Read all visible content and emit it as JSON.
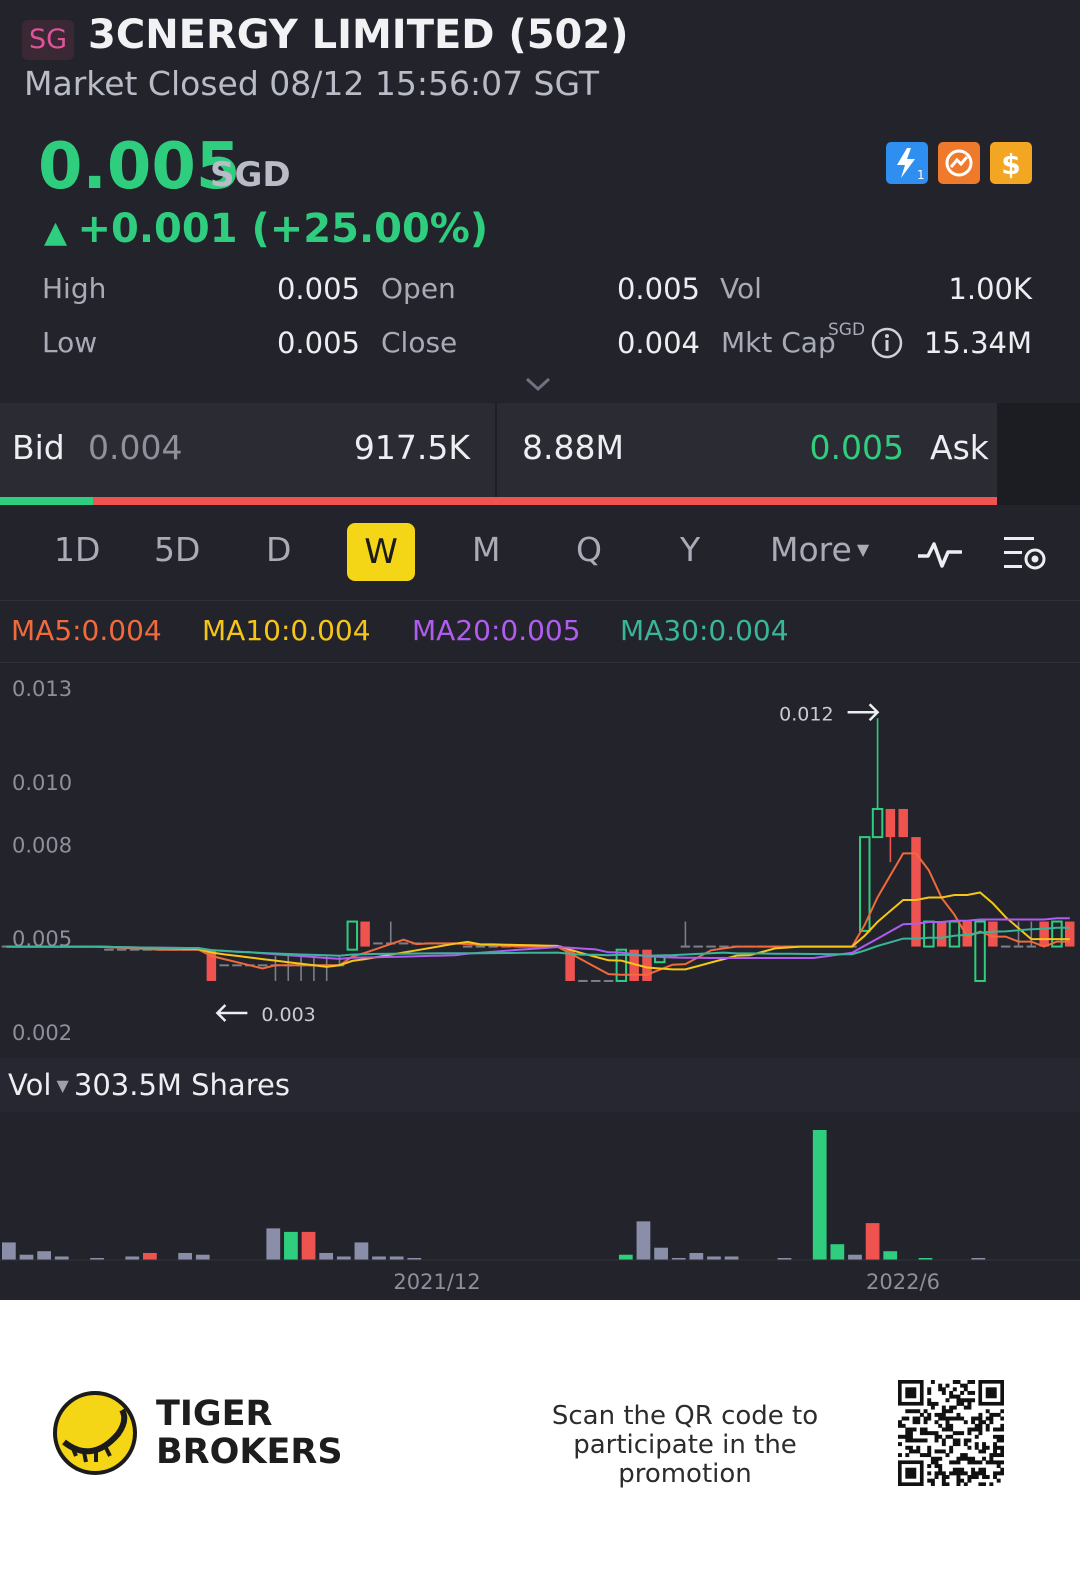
{
  "header": {
    "market_badge": "SG",
    "title": "3CNERGY LIMITED (502)",
    "status": "Market Closed 08/12 15:56:07 SGT"
  },
  "quote": {
    "price": "0.005",
    "currency": "SGD",
    "change": "+0.001 (+25.00%)",
    "up_color": "#2fce7e",
    "down_color": "#ef5350"
  },
  "icons": [
    "lightning-icon",
    "trade-icon",
    "dollar-icon"
  ],
  "stats": {
    "high_label": "High",
    "high": "0.005",
    "open_label": "Open",
    "open": "0.005",
    "vol_label": "Vol",
    "vol": "1.00K",
    "low_label": "Low",
    "low": "0.005",
    "close_label": "Close",
    "close": "0.004",
    "mktcap_label": "Mkt Cap",
    "mktcap_currency": "SGD",
    "mktcap": "15.34M"
  },
  "orderbook": {
    "bid_label": "Bid",
    "bid_price": "0.004",
    "bid_size": "917.5K",
    "ask_size": "8.88M",
    "ask_price": "0.005",
    "ask_label": "Ask",
    "bid_ratio": 0.093
  },
  "periods": [
    "1D",
    "5D",
    "D",
    "W",
    "M",
    "Q",
    "Y"
  ],
  "active_period": "W",
  "more_label": "More",
  "ma": {
    "ma5": "MA5:0.004",
    "ma10": "MA10:0.004",
    "ma20": "MA20:0.005",
    "ma30": "MA30:0.004",
    "ma5_color": "#f06a3c",
    "ma10_color": "#f5c518",
    "ma20_color": "#b15cf0",
    "ma30_color": "#39b59a"
  },
  "volume_header": {
    "label": "Vol",
    "value": "303.5M Shares"
  },
  "footer": {
    "brand_line1": "TIGER",
    "brand_line2": "BROKERS",
    "scan_line1": "Scan the QR code to",
    "scan_line2": "participate in the promotion"
  },
  "chart_data": {
    "type": "candlestick",
    "yticks": [
      "0.013",
      "0.010",
      "0.008",
      "0.005",
      "0.002"
    ],
    "ylim": [
      0.002,
      0.013
    ],
    "xticks": [
      "2021/12",
      "2022/6"
    ],
    "max_annotation": "0.012",
    "min_annotation": "0.003",
    "candles": [
      {
        "o": 0.0047,
        "h": 0.0047,
        "l": 0.0047,
        "c": 0.0047
      },
      {
        "o": 0.0047,
        "h": 0.0047,
        "l": 0.0047,
        "c": 0.0047
      },
      {
        "o": 0.0047,
        "h": 0.0047,
        "l": 0.0047,
        "c": 0.0047
      },
      {
        "o": 0.0047,
        "h": 0.0047,
        "l": 0.0047,
        "c": 0.0047
      },
      {
        "o": 0.0047,
        "h": 0.0047,
        "l": 0.0047,
        "c": 0.0047
      },
      {
        "o": 0.0047,
        "h": 0.0047,
        "l": 0.0047,
        "c": 0.0047
      },
      {
        "o": 0.0047,
        "h": 0.0047,
        "l": 0.0047,
        "c": 0.0047
      },
      {
        "o": 0.0047,
        "h": 0.0047,
        "l": 0.0047,
        "c": 0.0047
      },
      {
        "o": 0.0046,
        "h": 0.0046,
        "l": 0.0046,
        "c": 0.0046
      },
      {
        "o": 0.0046,
        "h": 0.0046,
        "l": 0.0046,
        "c": 0.0046
      },
      {
        "o": 0.0046,
        "h": 0.0046,
        "l": 0.0046,
        "c": 0.0046
      },
      {
        "o": 0.0046,
        "h": 0.0046,
        "l": 0.0046,
        "c": 0.0046
      },
      {
        "o": 0.0046,
        "h": 0.0046,
        "l": 0.0046,
        "c": 0.0046
      },
      {
        "o": 0.0046,
        "h": 0.0046,
        "l": 0.0046,
        "c": 0.0046
      },
      {
        "o": 0.0046,
        "h": 0.0046,
        "l": 0.0046,
        "c": 0.0046
      },
      {
        "o": 0.0046,
        "h": 0.0046,
        "l": 0.0046,
        "c": 0.0046
      },
      {
        "o": 0.0046,
        "h": 0.0046,
        "l": 0.0036,
        "c": 0.0036
      },
      {
        "o": 0.0041,
        "h": 0.0041,
        "l": 0.0041,
        "c": 0.0041
      },
      {
        "o": 0.0041,
        "h": 0.0041,
        "l": 0.0041,
        "c": 0.0041
      },
      {
        "o": 0.0041,
        "h": 0.0041,
        "l": 0.0041,
        "c": 0.0041
      },
      {
        "o": 0.0041,
        "h": 0.0041,
        "l": 0.0041,
        "c": 0.0041
      },
      {
        "o": 0.0041,
        "h": 0.0044,
        "l": 0.0036,
        "c": 0.0041
      },
      {
        "o": 0.0041,
        "h": 0.0044,
        "l": 0.0036,
        "c": 0.0041
      },
      {
        "o": 0.0041,
        "h": 0.0044,
        "l": 0.0036,
        "c": 0.0041
      },
      {
        "o": 0.0041,
        "h": 0.0044,
        "l": 0.0036,
        "c": 0.0041
      },
      {
        "o": 0.0041,
        "h": 0.0044,
        "l": 0.0036,
        "c": 0.0041
      },
      {
        "o": 0.0041,
        "h": 0.0044,
        "l": 0.0041,
        "c": 0.0041
      },
      {
        "o": 0.0046,
        "h": 0.0055,
        "l": 0.0046,
        "c": 0.0055
      },
      {
        "o": 0.0055,
        "h": 0.0055,
        "l": 0.0047,
        "c": 0.0047
      },
      {
        "o": 0.0048,
        "h": 0.0048,
        "l": 0.0048,
        "c": 0.0048
      },
      {
        "o": 0.0048,
        "h": 0.0055,
        "l": 0.0048,
        "c": 0.0048
      },
      {
        "o": 0.0048,
        "h": 0.0048,
        "l": 0.0048,
        "c": 0.0048
      },
      {
        "o": 0.0048,
        "h": 0.0048,
        "l": 0.0048,
        "c": 0.0048
      },
      {
        "o": 0.0048,
        "h": 0.0048,
        "l": 0.0048,
        "c": 0.0048
      },
      {
        "o": 0.0048,
        "h": 0.0048,
        "l": 0.0048,
        "c": 0.0048
      },
      {
        "o": 0.0048,
        "h": 0.0048,
        "l": 0.0048,
        "c": 0.0048
      },
      {
        "o": 0.0047,
        "h": 0.0047,
        "l": 0.0047,
        "c": 0.0047
      },
      {
        "o": 0.0047,
        "h": 0.0047,
        "l": 0.0047,
        "c": 0.0047
      },
      {
        "o": 0.0047,
        "h": 0.0047,
        "l": 0.0047,
        "c": 0.0047
      },
      {
        "o": 0.0047,
        "h": 0.0047,
        "l": 0.0047,
        "c": 0.0047
      },
      {
        "o": 0.0047,
        "h": 0.0047,
        "l": 0.0047,
        "c": 0.0047
      },
      {
        "o": 0.0047,
        "h": 0.0047,
        "l": 0.0047,
        "c": 0.0047
      },
      {
        "o": 0.0047,
        "h": 0.0047,
        "l": 0.0047,
        "c": 0.0047
      },
      {
        "o": 0.0047,
        "h": 0.0047,
        "l": 0.0047,
        "c": 0.0047
      },
      {
        "o": 0.0046,
        "h": 0.0046,
        "l": 0.0036,
        "c": 0.0036
      },
      {
        "o": 0.0036,
        "h": 0.0036,
        "l": 0.0036,
        "c": 0.0036
      },
      {
        "o": 0.0036,
        "h": 0.0036,
        "l": 0.0036,
        "c": 0.0036
      },
      {
        "o": 0.0036,
        "h": 0.0036,
        "l": 0.0036,
        "c": 0.0036
      },
      {
        "o": 0.0036,
        "h": 0.0046,
        "l": 0.0036,
        "c": 0.0046
      },
      {
        "o": 0.0046,
        "h": 0.0046,
        "l": 0.0036,
        "c": 0.0036
      },
      {
        "o": 0.0046,
        "h": 0.0046,
        "l": 0.0036,
        "c": 0.0036
      },
      {
        "o": 0.0042,
        "h": 0.0044,
        "l": 0.0042,
        "c": 0.0044
      },
      {
        "o": 0.0044,
        "h": 0.0044,
        "l": 0.0044,
        "c": 0.0044
      },
      {
        "o": 0.0047,
        "h": 0.0055,
        "l": 0.0047,
        "c": 0.0047
      },
      {
        "o": 0.0047,
        "h": 0.0047,
        "l": 0.0047,
        "c": 0.0047
      },
      {
        "o": 0.0047,
        "h": 0.0047,
        "l": 0.0047,
        "c": 0.0047
      },
      {
        "o": 0.0047,
        "h": 0.0047,
        "l": 0.0047,
        "c": 0.0047
      },
      {
        "o": 0.0047,
        "h": 0.0047,
        "l": 0.0047,
        "c": 0.0047
      },
      {
        "o": 0.0047,
        "h": 0.0047,
        "l": 0.0047,
        "c": 0.0047
      },
      {
        "o": 0.0047,
        "h": 0.0047,
        "l": 0.0047,
        "c": 0.0047
      },
      {
        "o": 0.0047,
        "h": 0.0047,
        "l": 0.0047,
        "c": 0.0047
      },
      {
        "o": 0.0047,
        "h": 0.0047,
        "l": 0.0047,
        "c": 0.0047
      },
      {
        "o": 0.0047,
        "h": 0.0047,
        "l": 0.0047,
        "c": 0.0047
      },
      {
        "o": 0.0047,
        "h": 0.0047,
        "l": 0.0047,
        "c": 0.0047
      },
      {
        "o": 0.0047,
        "h": 0.0047,
        "l": 0.0047,
        "c": 0.0047
      },
      {
        "o": 0.0047,
        "h": 0.0047,
        "l": 0.0047,
        "c": 0.0047
      },
      {
        "o": 0.0047,
        "h": 0.0047,
        "l": 0.0047,
        "c": 0.0047
      },
      {
        "o": 0.0052,
        "h": 0.0082,
        "l": 0.0052,
        "c": 0.0082
      },
      {
        "o": 0.0082,
        "h": 0.012,
        "l": 0.0082,
        "c": 0.0091
      },
      {
        "o": 0.0091,
        "h": 0.0091,
        "l": 0.0074,
        "c": 0.0082
      },
      {
        "o": 0.0091,
        "h": 0.0091,
        "l": 0.0082,
        "c": 0.0082
      },
      {
        "o": 0.0082,
        "h": 0.0082,
        "l": 0.0047,
        "c": 0.0047
      },
      {
        "o": 0.0047,
        "h": 0.0055,
        "l": 0.0047,
        "c": 0.0055
      },
      {
        "o": 0.0055,
        "h": 0.0055,
        "l": 0.0047,
        "c": 0.0047
      },
      {
        "o": 0.0047,
        "h": 0.0055,
        "l": 0.0047,
        "c": 0.0055
      },
      {
        "o": 0.0055,
        "h": 0.0055,
        "l": 0.0047,
        "c": 0.0047
      },
      {
        "o": 0.0036,
        "h": 0.0055,
        "l": 0.0036,
        "c": 0.0055
      },
      {
        "o": 0.0055,
        "h": 0.0055,
        "l": 0.0047,
        "c": 0.0047
      },
      {
        "o": 0.0047,
        "h": 0.0047,
        "l": 0.0047,
        "c": 0.0047
      },
      {
        "o": 0.0047,
        "h": 0.0055,
        "l": 0.0047,
        "c": 0.0047
      },
      {
        "o": 0.0047,
        "h": 0.0055,
        "l": 0.0047,
        "c": 0.0047
      },
      {
        "o": 0.0055,
        "h": 0.0055,
        "l": 0.0047,
        "c": 0.0047
      },
      {
        "o": 0.0047,
        "h": 0.0055,
        "l": 0.0047,
        "c": 0.0055
      },
      {
        "o": 0.0055,
        "h": 0.0055,
        "l": 0.0047,
        "c": 0.0047
      }
    ],
    "volumes": [
      {
        "v": 0.1,
        "up": false
      },
      {
        "v": 0.03,
        "up": false
      },
      {
        "v": 0.05,
        "up": false
      },
      {
        "v": 0.02,
        "up": false
      },
      {
        "v": 0.0,
        "up": false
      },
      {
        "v": 0.01,
        "up": false
      },
      {
        "v": 0.0,
        "up": false
      },
      {
        "v": 0.02,
        "up": false
      },
      {
        "v": 0.04,
        "up": false
      },
      {
        "v": 0.0,
        "up": false
      },
      {
        "v": 0.04,
        "up": false
      },
      {
        "v": 0.03,
        "up": false
      },
      {
        "v": 0.0,
        "up": false
      },
      {
        "v": 0.0,
        "up": false
      },
      {
        "v": 0.0,
        "up": false
      },
      {
        "v": 0.18,
        "up": false
      },
      {
        "v": 0.16,
        "up": true
      },
      {
        "v": 0.16,
        "up": false
      },
      {
        "v": 0.04,
        "up": false
      },
      {
        "v": 0.02,
        "up": false
      },
      {
        "v": 0.1,
        "up": false
      },
      {
        "v": 0.02,
        "up": false
      },
      {
        "v": 0.02,
        "up": false
      },
      {
        "v": 0.01,
        "up": false
      },
      {
        "v": 0.0,
        "up": false
      },
      {
        "v": 0.0,
        "up": false
      },
      {
        "v": 0.0,
        "up": false
      },
      {
        "v": 0.0,
        "up": false
      },
      {
        "v": 0.0,
        "up": false
      },
      {
        "v": 0.0,
        "up": false
      },
      {
        "v": 0.0,
        "up": false
      },
      {
        "v": 0.0,
        "up": false
      },
      {
        "v": 0.0,
        "up": false
      },
      {
        "v": 0.0,
        "up": false
      },
      {
        "v": 0.0,
        "up": false
      },
      {
        "v": 0.03,
        "up": true
      },
      {
        "v": 0.22,
        "up": false
      },
      {
        "v": 0.07,
        "up": false
      },
      {
        "v": 0.01,
        "up": false
      },
      {
        "v": 0.04,
        "up": false
      },
      {
        "v": 0.02,
        "up": false
      },
      {
        "v": 0.02,
        "up": false
      },
      {
        "v": 0.0,
        "up": false
      },
      {
        "v": 0.0,
        "up": false
      },
      {
        "v": 0.01,
        "up": false
      },
      {
        "v": 0.0,
        "up": false
      },
      {
        "v": 0.74,
        "up": true
      },
      {
        "v": 0.09,
        "up": true
      },
      {
        "v": 0.03,
        "up": false
      },
      {
        "v": 0.21,
        "up": false
      },
      {
        "v": 0.05,
        "up": true
      },
      {
        "v": 0.0,
        "up": false
      },
      {
        "v": 0.01,
        "up": true
      },
      {
        "v": 0.0,
        "up": false
      },
      {
        "v": 0.0,
        "up": false
      },
      {
        "v": 0.01,
        "up": false
      },
      {
        "v": 0.0,
        "up": false
      },
      {
        "v": 0.0,
        "up": false
      },
      {
        "v": 0.0,
        "up": false
      }
    ]
  }
}
